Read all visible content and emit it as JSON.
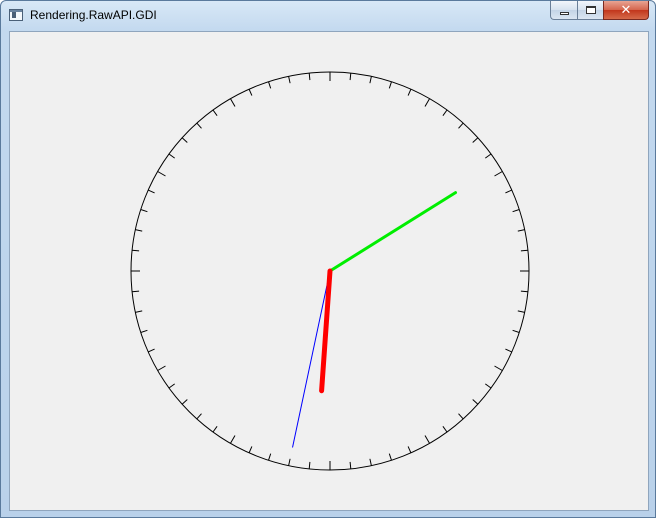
{
  "window": {
    "title": "Rendering.RawAPI.GDI",
    "icon": "app-window-icon",
    "caption_buttons": [
      "minimize",
      "maximize",
      "close"
    ]
  },
  "clock": {
    "tick_count": 60,
    "hands": [
      {
        "name": "hour",
        "color": "#ff0000",
        "angle_deg": 184
      },
      {
        "name": "minute",
        "color": "#00ee00",
        "angle_deg": 58
      },
      {
        "name": "second",
        "color": "#0000ff",
        "angle_deg": 192
      }
    ],
    "colors": {
      "face": "#000000",
      "background": "#f0f0f0"
    }
  }
}
